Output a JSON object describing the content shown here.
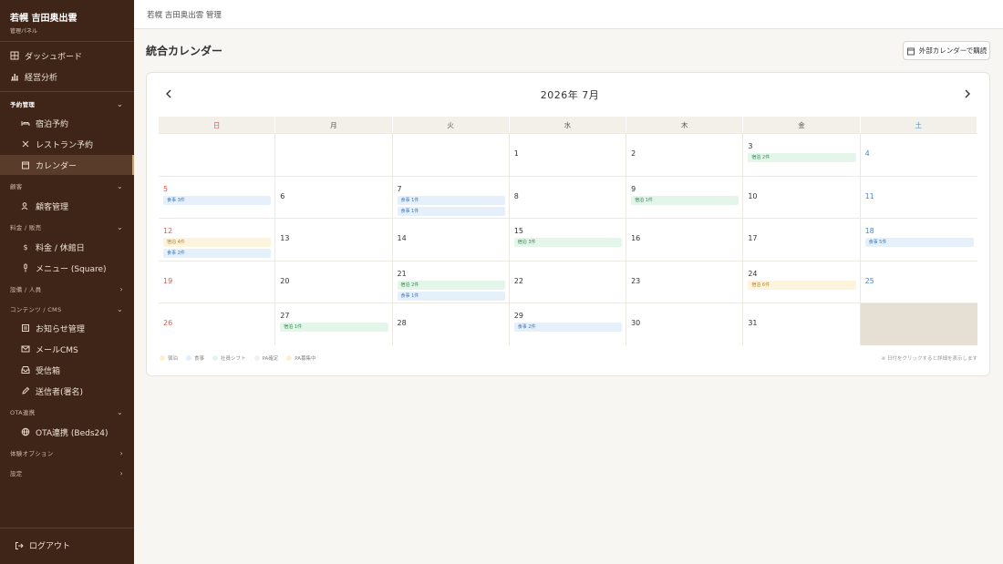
{
  "brand": {
    "title": "若幌 吉田奥出雲",
    "subtitle": "管理パネル"
  },
  "sidebar": {
    "dashboard": "ダッシュボード",
    "analytics": "経営分析",
    "group_reservations": "予約管理",
    "lodging": "宿泊予約",
    "restaurant": "レストラン予約",
    "calendar": "カレンダー",
    "group_customers": "顧客",
    "customers": "顧客管理",
    "group_pricing": "料金 / 販売",
    "rates": "料金 / 休館日",
    "menu": "メニュー (Square)",
    "group_facilities": "設備 / 人員",
    "group_content": "コンテンツ / CMS",
    "news": "お知らせ管理",
    "mail_cms": "メールCMS",
    "inbox": "受信箱",
    "senders": "送信者(署名)",
    "group_ota": "OTA連携",
    "ota_beds24": "OTA連携 (Beds24)",
    "group_experience": "体験オプション",
    "group_settings": "設定",
    "logout": "ログアウト"
  },
  "header": {
    "title": "若幌 吉田奥出雲 管理"
  },
  "page": {
    "title": "統合カレンダー",
    "subscribe_button": "外部カレンダーで購読"
  },
  "calendar": {
    "month_title": "2026年 7月",
    "days_of_week": [
      "日",
      "月",
      "火",
      "水",
      "木",
      "金",
      "土"
    ],
    "weeks": [
      [
        {
          "day": ""
        },
        {
          "day": ""
        },
        {
          "day": ""
        },
        {
          "day": "1"
        },
        {
          "day": "2"
        },
        {
          "day": "3",
          "events": [
            {
              "type": "shift",
              "label": "宿泊 2件"
            }
          ]
        },
        {
          "day": "4"
        }
      ],
      [
        {
          "day": "5",
          "events": [
            {
              "type": "meal",
              "label": "食事 3件"
            }
          ]
        },
        {
          "day": "6"
        },
        {
          "day": "7",
          "events": [
            {
              "type": "meal",
              "label": "食事 1件"
            },
            {
              "type": "meal",
              "label": "食事 1件"
            }
          ]
        },
        {
          "day": "8"
        },
        {
          "day": "9",
          "events": [
            {
              "type": "shift",
              "label": "宿泊 1件"
            }
          ]
        },
        {
          "day": "10"
        },
        {
          "day": "11"
        }
      ],
      [
        {
          "day": "12",
          "events": [
            {
              "type": "stay",
              "label": "宿泊 4件"
            },
            {
              "type": "meal",
              "label": "食事 2件"
            }
          ]
        },
        {
          "day": "13"
        },
        {
          "day": "14"
        },
        {
          "day": "15",
          "events": [
            {
              "type": "shift",
              "label": "宿泊 3件"
            }
          ]
        },
        {
          "day": "16"
        },
        {
          "day": "17"
        },
        {
          "day": "18",
          "events": [
            {
              "type": "meal",
              "label": "食事 5件"
            }
          ]
        }
      ],
      [
        {
          "day": "19"
        },
        {
          "day": "20"
        },
        {
          "day": "21",
          "events": [
            {
              "type": "shift",
              "label": "宿泊 2件"
            },
            {
              "type": "meal",
              "label": "食事 1件"
            }
          ]
        },
        {
          "day": "22"
        },
        {
          "day": "23"
        },
        {
          "day": "24",
          "events": [
            {
              "type": "stay",
              "label": "宿泊 6件"
            }
          ]
        },
        {
          "day": "25"
        }
      ],
      [
        {
          "day": "26"
        },
        {
          "day": "27",
          "events": [
            {
              "type": "shift",
              "label": "宿泊 1件"
            }
          ]
        },
        {
          "day": "28"
        },
        {
          "day": "29",
          "events": [
            {
              "type": "meal",
              "label": "食事 2件"
            }
          ]
        },
        {
          "day": "30"
        },
        {
          "day": "31"
        },
        {
          "day": "",
          "greyed": true
        }
      ]
    ],
    "legend": [
      {
        "label": "宿泊",
        "color": "#fdf0d2"
      },
      {
        "label": "食事",
        "color": "#e3eefb"
      },
      {
        "label": "社員シフト",
        "color": "#e2f5e8"
      },
      {
        "label": "PA確定",
        "color": "#eef2f8"
      },
      {
        "label": "PA募集中",
        "color": "#fbf1d6"
      }
    ],
    "hint": "※ 日付をクリックすると詳細を表示します"
  },
  "colors": {
    "sidebar_bg": "#3e2517",
    "accent": "#c9a26a",
    "sunday": "#e05a4f",
    "saturday": "#3a8ad8"
  }
}
